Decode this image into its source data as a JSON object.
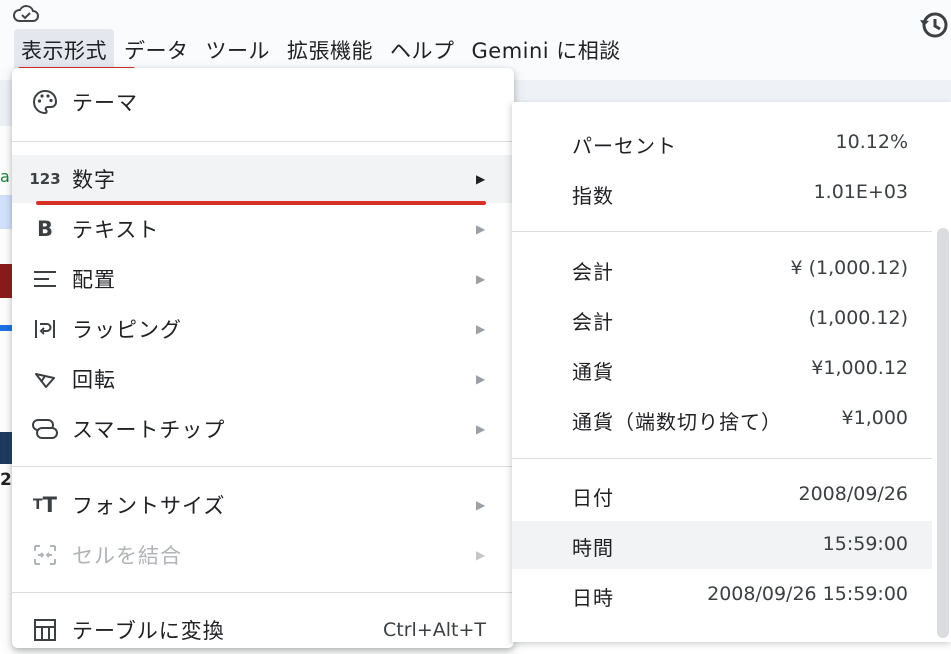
{
  "menubar": {
    "items": [
      "表示形式",
      "データ",
      "ツール",
      "拡張機能",
      "ヘルプ",
      "Gemini に相談"
    ]
  },
  "menu": {
    "items": [
      {
        "label": "テーマ"
      },
      {
        "label": "数字"
      },
      {
        "label": "テキスト"
      },
      {
        "label": "配置"
      },
      {
        "label": "ラッピング"
      },
      {
        "label": "回転"
      },
      {
        "label": "スマートチップ"
      },
      {
        "label": "フォントサイズ"
      },
      {
        "label": "セルを結合"
      },
      {
        "label": "テーブルに変換",
        "shortcut": "Ctrl+Alt+T"
      }
    ]
  },
  "submenu": {
    "rows": [
      {
        "label": "パーセント",
        "value": "10.12%"
      },
      {
        "label": "指数",
        "value": "1.01E+03"
      },
      {
        "label": "会計",
        "value": "¥ (1,000.12)"
      },
      {
        "label": "会計",
        "value": "(1,000.12)"
      },
      {
        "label": "通貨",
        "value": "¥1,000.12"
      },
      {
        "label": "通貨（端数切り捨て）",
        "value": "¥1,000"
      },
      {
        "label": "日付",
        "value": "2008/09/26"
      },
      {
        "label": "時間",
        "value": "15:59:00"
      },
      {
        "label": "日時",
        "value": "2008/09/26 15:59:00"
      }
    ]
  },
  "background": {
    "fragments": [
      "a",
      "2"
    ]
  },
  "colors": {
    "highlight": "#f1f3f4",
    "annotation": "#d93025"
  }
}
